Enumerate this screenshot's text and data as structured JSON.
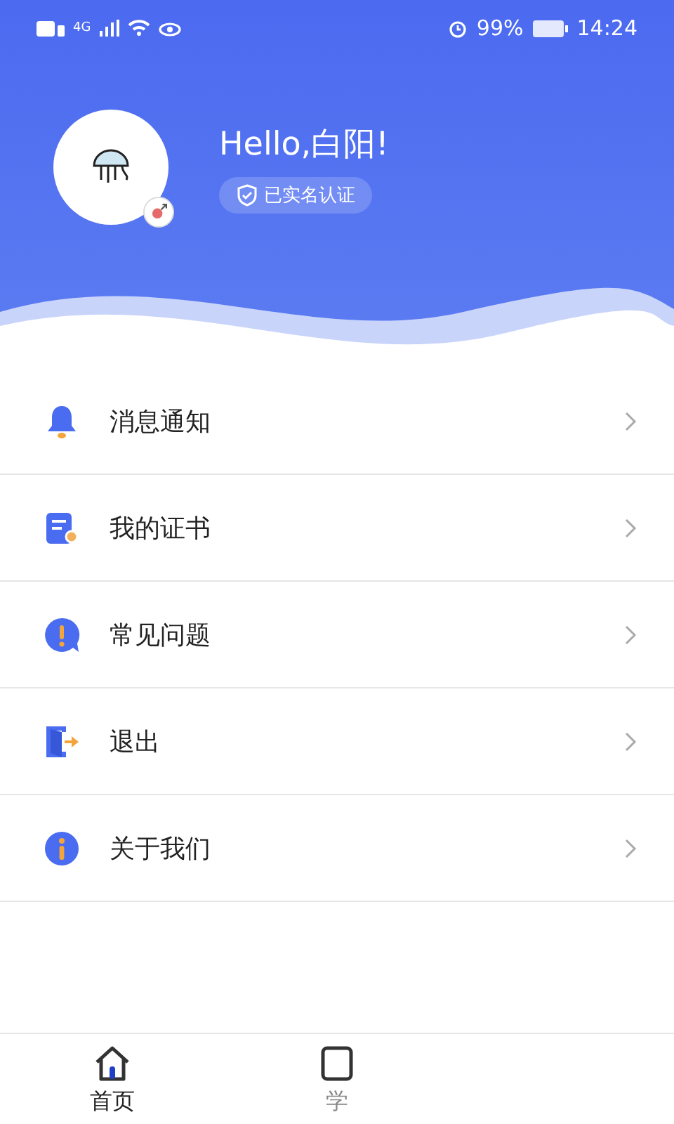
{
  "status_bar": {
    "network": "4G",
    "battery": "99%",
    "time": "14:24"
  },
  "profile": {
    "greeting": "Hello,白阳!",
    "verified_badge": "已实名认证"
  },
  "menu": [
    {
      "kind": "bell",
      "label": "消息通知"
    },
    {
      "kind": "certificate",
      "label": "我的证书"
    },
    {
      "kind": "faq",
      "label": "常见问题"
    },
    {
      "kind": "exit",
      "label": "退出"
    },
    {
      "kind": "about",
      "label": "关于我们"
    }
  ],
  "tab_bar": [
    {
      "kind": "home",
      "label": "首页",
      "selected": true
    },
    {
      "kind": "study",
      "label": "学",
      "selected": false
    }
  ]
}
